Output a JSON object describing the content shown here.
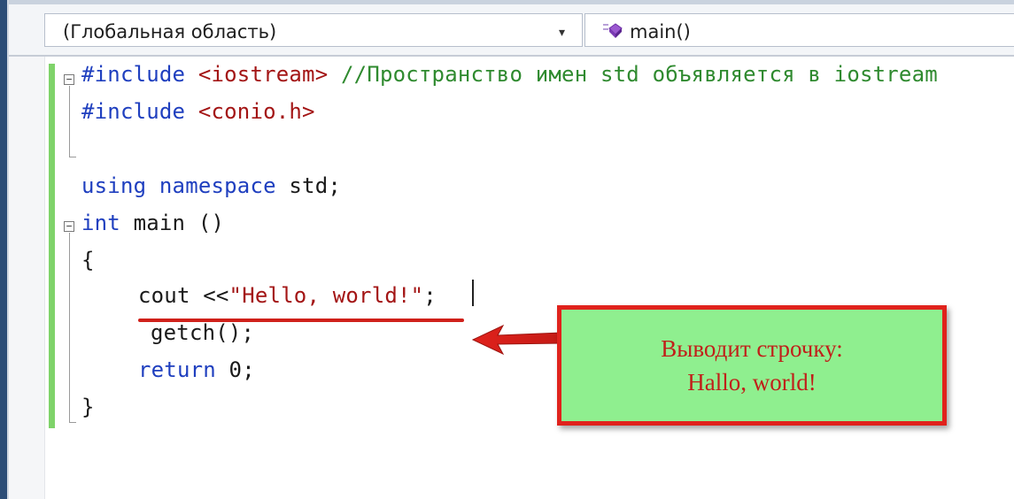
{
  "navbar": {
    "scope_label": "(Глобальная область)",
    "dropdown_arrow": "▾",
    "member_label": "main()",
    "member_icon": "method-icon"
  },
  "editor": {
    "lines": {
      "include1_directive": "#include",
      "include1_header": "<iostream>",
      "include1_comment": "//Пространство имен std объявляется в iostream",
      "include2_directive": "#include",
      "include2_header": "<conio.h>",
      "using_kw": "using namespace",
      "using_rest": " std;",
      "main_kw": "int",
      "main_rest": " main ()",
      "open_brace": "{",
      "cout_pre": "cout <<",
      "cout_str": "\"Hello, world!\"",
      "cout_post": ";",
      "getch": "getch();",
      "return_kw": "return",
      "return_rest": " 0;",
      "close_brace": "}"
    }
  },
  "callout": {
    "line1": "Выводит строчку:",
    "line2": "Hallo, world!"
  },
  "colors": {
    "keyword": "#1f3fbf",
    "string": "#a31515",
    "comment": "#2f8a2f",
    "callout_bg": "#8fef8f",
    "callout_border": "#e0221c",
    "change_bar": "#7fd36a"
  }
}
